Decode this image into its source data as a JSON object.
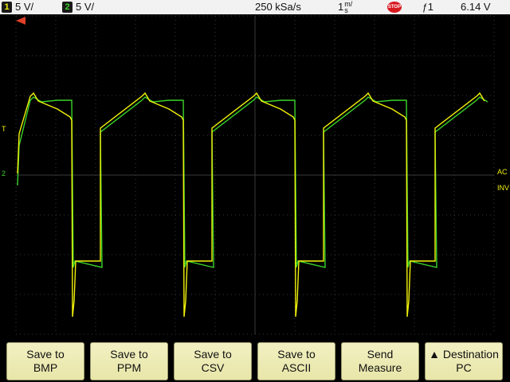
{
  "header": {
    "ch1_badge": "1",
    "ch1_scale": "5 V/",
    "ch2_badge": "2",
    "ch2_scale": "5 V/",
    "sample_rate": "250 kSa/s",
    "timebase_value": "1",
    "timebase_unit_top": "m/",
    "timebase_unit_bottom": "s",
    "run_state": "STOP",
    "trigger_source": "1",
    "trigger_level": "6.14 V"
  },
  "markers": {
    "trigger_level_marker": "T",
    "ch2_ground_marker": "2",
    "ch1_coupling_right": "AC",
    "ch1_invert_right": "INV"
  },
  "softkeys": [
    {
      "label": "Save to\nBMP"
    },
    {
      "label": "Save to\nPPM"
    },
    {
      "label": "Save to\nCSV"
    },
    {
      "label": "Save to\nASCII"
    },
    {
      "label": "Send\nMeasure"
    },
    {
      "label": "▲ Destination\nPC"
    }
  ],
  "colors": {
    "ch1": "#f2f20a",
    "ch2": "#3ad22a",
    "grid": "#3a3a3a",
    "trigger_pos": "#e0402a"
  }
}
